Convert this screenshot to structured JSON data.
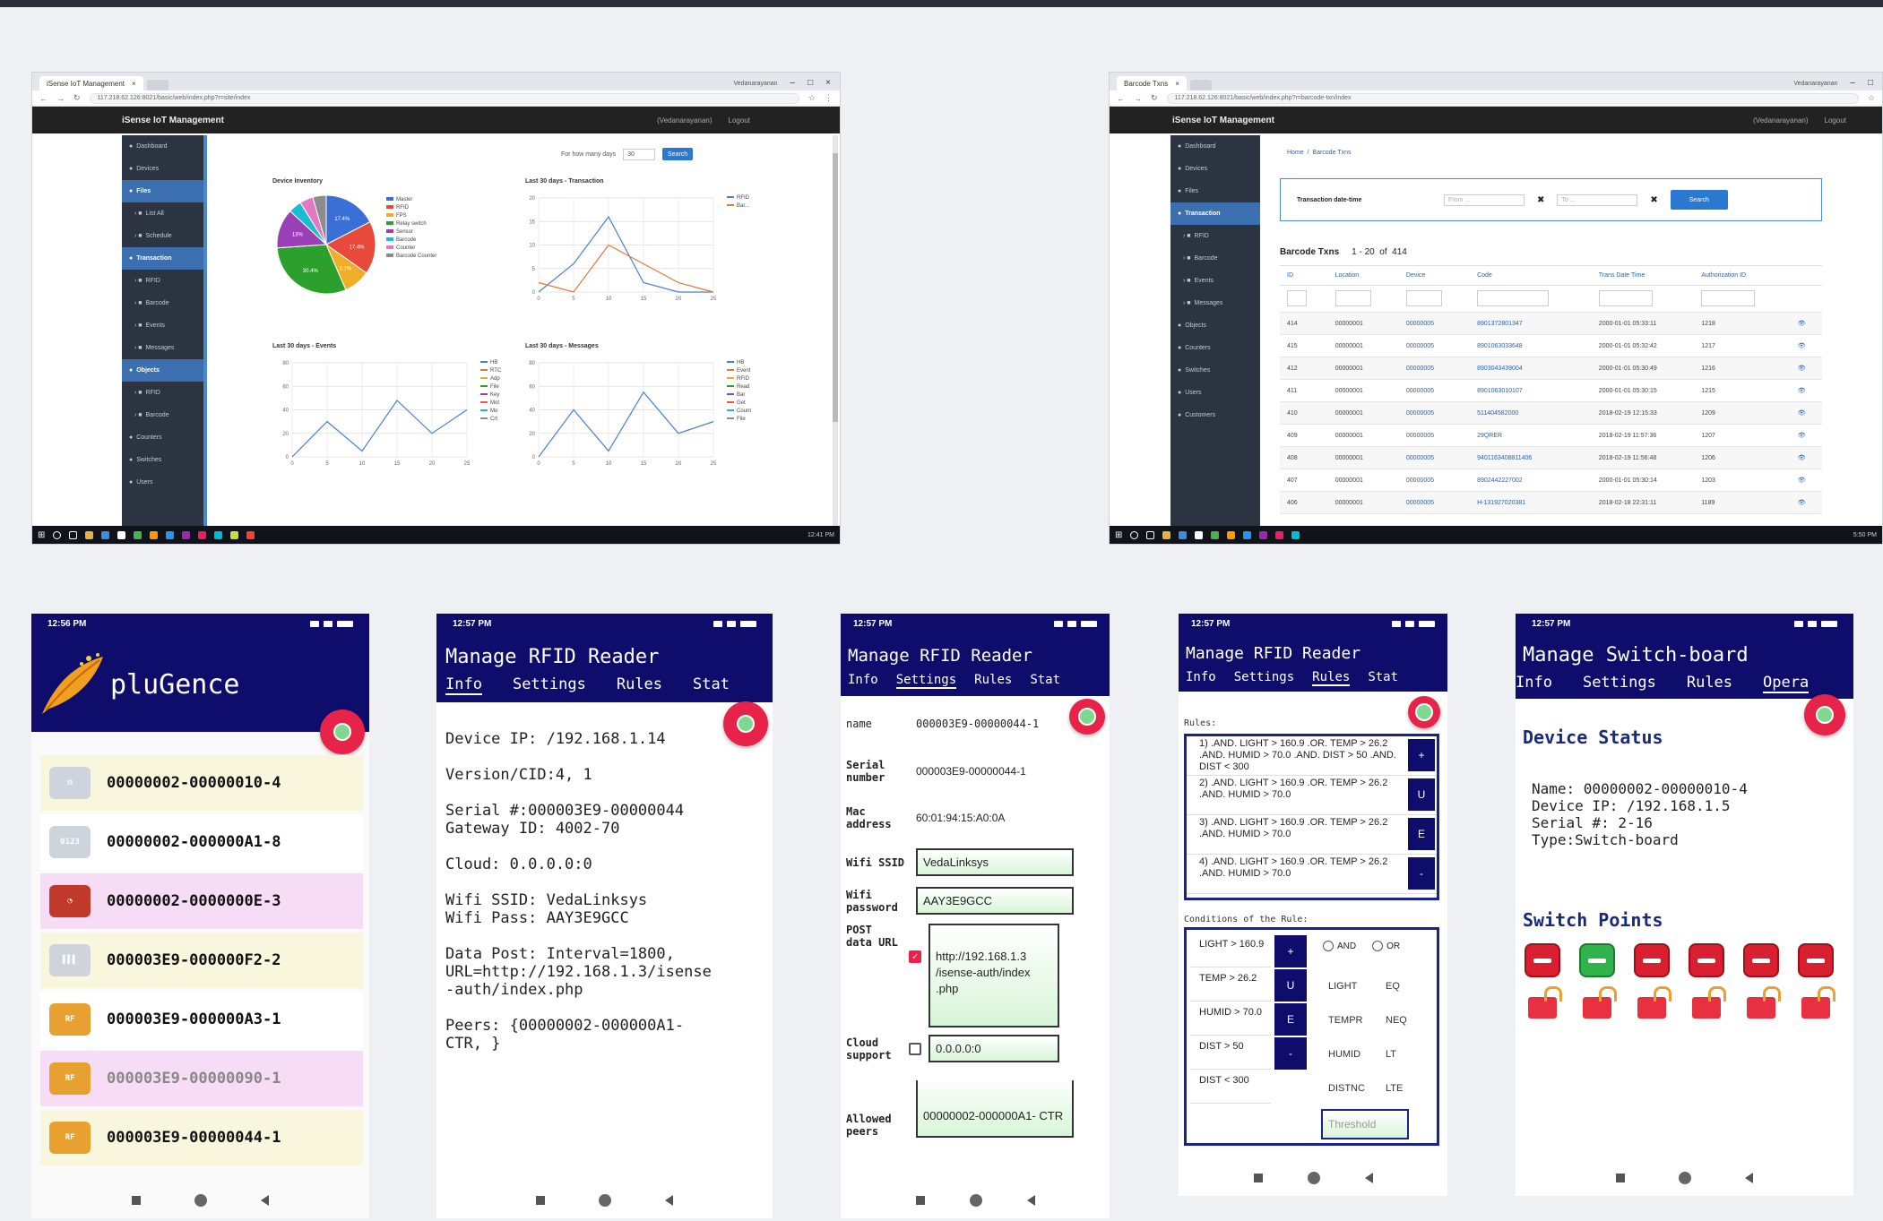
{
  "browser1": {
    "tab_title": "iSense IoT Management",
    "user": "Vedanarayanan",
    "url": "117.218.62.126:8021/basic/web/index.php?r=site/index",
    "app_title": "iSense IoT Management",
    "user_link": "(Vedanarayanan)",
    "logout": "Logout",
    "filter_label": "For how many days",
    "filter_value": "30",
    "search_button": "Search",
    "sidebar": [
      {
        "label": "Dashboard",
        "active": false,
        "sub": false
      },
      {
        "label": "Devices",
        "active": false,
        "sub": false
      },
      {
        "label": "Files",
        "active": true,
        "sub": false
      },
      {
        "label": "List All",
        "active": false,
        "sub": true
      },
      {
        "label": "Schedule",
        "active": false,
        "sub": true
      },
      {
        "label": "Transaction",
        "active": true,
        "sub": false
      },
      {
        "label": "RFID",
        "active": false,
        "sub": true
      },
      {
        "label": "Barcode",
        "active": false,
        "sub": true
      },
      {
        "label": "Events",
        "active": false,
        "sub": true
      },
      {
        "label": "Messages",
        "active": false,
        "sub": true
      },
      {
        "label": "Objects",
        "active": true,
        "sub": false
      },
      {
        "label": "RFID",
        "active": false,
        "sub": true
      },
      {
        "label": "Barcode",
        "active": false,
        "sub": true
      },
      {
        "label": "Counters",
        "active": false,
        "sub": false
      },
      {
        "label": "Switches",
        "active": false,
        "sub": false
      },
      {
        "label": "Users",
        "active": false,
        "sub": false
      }
    ],
    "time": "12:41 PM"
  },
  "charts_text": {
    "pie_title": "Device Inventory",
    "pie_legend": [
      "Master",
      "RFID",
      "FPS",
      "Relay switch",
      "Sensor",
      "Barcode",
      "Counter",
      "Barcode Counter"
    ],
    "pie_colors": [
      "#3b6fd8",
      "#e74a3b",
      "#f0ad2a",
      "#2ca02c",
      "#9b3fb5",
      "#17becf",
      "#e377c2",
      "#8c8c8c"
    ],
    "pie_labels": [
      "17.4%",
      "17.4%",
      "8.7%",
      "30.4%",
      "13%"
    ],
    "txn_title": "Last 30 days - Transaction",
    "txn_legend": [
      "RFID",
      "Bar..."
    ],
    "events_title": "Last 30 days - Events",
    "events_legend": [
      "HB",
      "RTC",
      "Adp",
      "File",
      "Key",
      "Mot",
      "Mo",
      "Crt"
    ],
    "messages_title": "Last 30 days - Messages",
    "messages_legend": [
      "HB",
      "Event",
      "RFID",
      "Read",
      "Bar",
      "Get",
      "Count",
      "File"
    ]
  },
  "chart_data": [
    {
      "type": "pie",
      "title": "Device Inventory",
      "categories": [
        "Master",
        "RFID",
        "FPS",
        "Relay switch",
        "Sensor",
        "Barcode",
        "Counter",
        "Barcode Counter"
      ],
      "values": [
        17.4,
        17.4,
        8.7,
        30.4,
        13,
        4.3,
        4.4,
        4.4
      ]
    },
    {
      "type": "line",
      "title": "Last 30 days - Transaction",
      "x": [
        0,
        5,
        10,
        15,
        20,
        25
      ],
      "series": [
        {
          "name": "RFID",
          "values": [
            0,
            6,
            16,
            2,
            0,
            0
          ]
        },
        {
          "name": "Bar...",
          "values": [
            2,
            0,
            10,
            6,
            2,
            0
          ]
        }
      ],
      "ylim": [
        0,
        20
      ]
    },
    {
      "type": "line",
      "title": "Last 30 days - Events",
      "x": [
        0,
        5,
        10,
        15,
        20,
        25
      ],
      "series": [
        {
          "name": "HB",
          "values": [
            0,
            30,
            5,
            48,
            20,
            40
          ]
        }
      ],
      "ylim": [
        0,
        80
      ]
    },
    {
      "type": "line",
      "title": "Last 30 days - Messages",
      "x": [
        0,
        5,
        10,
        15,
        20,
        25
      ],
      "series": [
        {
          "name": "HB",
          "values": [
            0,
            40,
            5,
            55,
            20,
            30
          ]
        }
      ],
      "ylim": [
        0,
        80
      ]
    }
  ],
  "browser2": {
    "tab_title": "Barcode Txns",
    "user": "Vedanarayanan",
    "url": "117.218.62.126:8021/basic/web/index.php?r=barcode-txn/index",
    "app_title": "iSense IoT Management",
    "user_link": "(Vedanarayanan)",
    "logout": "Logout",
    "breadcrumb": "Home  /  Barcode Txns",
    "filter_label": "Transaction date-time",
    "from": "From ...",
    "to": "To ...",
    "search": "Search",
    "table_title": "Barcode Txns",
    "range": "1 - 20  of  414",
    "columns": [
      "ID",
      "Location",
      "Device",
      "Code",
      "Trans Date Time",
      "Authorization ID"
    ],
    "rows": [
      [
        "414",
        "00000001",
        "00000005",
        "8901372801347",
        "2000-01-01 05:33:11",
        "1218"
      ],
      [
        "415",
        "00000001",
        "00000005",
        "8901063033648",
        "2000-01-01 05:32:42",
        "1217"
      ],
      [
        "412",
        "00000001",
        "00000005",
        "8903043439004",
        "2000-01-01 05:30:49",
        "1216"
      ],
      [
        "411",
        "00000001",
        "00000005",
        "8901063010107",
        "2000-01-01 05:30:15",
        "1215"
      ],
      [
        "410",
        "00000001",
        "00000005",
        "511404582000",
        "2018-02-19 12:15:33",
        "1209"
      ],
      [
        "409",
        "00000001",
        "00000005",
        "29QRER",
        "2018-02-19 11:57:36",
        "1207"
      ],
      [
        "408",
        "00000001",
        "00000005",
        "9401163408811406",
        "2018-02-19 11:56:48",
        "1206"
      ],
      [
        "407",
        "00000001",
        "00000005",
        "8902442227002",
        "2000-01-01 05:30:14",
        "1203"
      ],
      [
        "406",
        "00000001",
        "00000005",
        "H-131927020381",
        "2018-02-18 22:31:11",
        "1189"
      ]
    ],
    "sidebar": [
      {
        "label": "Dashboard",
        "active": false,
        "sub": false
      },
      {
        "label": "Devices",
        "active": false,
        "sub": false
      },
      {
        "label": "Files",
        "active": false,
        "sub": false
      },
      {
        "label": "Transaction",
        "active": true,
        "sub": false
      },
      {
        "label": "RFID",
        "active": false,
        "sub": true
      },
      {
        "label": "Barcode",
        "active": false,
        "sub": true
      },
      {
        "label": "Events",
        "active": false,
        "sub": true
      },
      {
        "label": "Messages",
        "active": false,
        "sub": true
      },
      {
        "label": "Objects",
        "active": false,
        "sub": false
      },
      {
        "label": "Counters",
        "active": false,
        "sub": false
      },
      {
        "label": "Switches",
        "active": false,
        "sub": false
      },
      {
        "label": "Users",
        "active": false,
        "sub": false
      },
      {
        "label": "Customers",
        "active": false,
        "sub": false
      }
    ],
    "time": "5:50 PM"
  },
  "phone1": {
    "time": "12:56 PM",
    "brand": "pluGence",
    "devices": [
      {
        "id": "00000002-00000010-4",
        "bg": "#f8f6dc",
        "icon": "switch-icon"
      },
      {
        "id": "00000002-000000A1-8",
        "bg": "#ffffff",
        "icon": "counter-icon"
      },
      {
        "id": "00000002-0000000E-3",
        "bg": "#f6dcf4",
        "icon": "gauge-icon"
      },
      {
        "id": "000003E9-000000F2-2",
        "bg": "#f8f6dc",
        "icon": "barcode-icon"
      },
      {
        "id": "000003E9-000000A3-1",
        "bg": "#ffffff",
        "icon": "rfid-icon"
      },
      {
        "id": "000003E9-00000090-1",
        "bg": "#f6dcf4",
        "icon": "rfid-icon"
      },
      {
        "id": "000003E9-00000044-1",
        "bg": "#f8f6dc",
        "icon": "rfid-icon"
      }
    ]
  },
  "phone2": {
    "time": "12:57 PM",
    "title": "Manage RFID Reader",
    "tabs": [
      "Info",
      "Settings",
      "Rules",
      "Stat"
    ],
    "info": [
      "Device IP: /192.168.1.14",
      "Version/CID:4, 1",
      "Serial #:000003E9-00000044",
      "Gateway ID: 4002-70",
      "Cloud: 0.0.0.0:0",
      "Wifi SSID: VedaLinksys",
      "Wifi Pass: AAY3E9GCC",
      "Data Post: Interval=1800,",
      "URL=http://192.168.1.3/isense",
      "-auth/index.php",
      "Peers: {00000002-000000A1-",
      "CTR, }"
    ]
  },
  "phone3": {
    "time": "12:57 PM",
    "title": "Manage RFID Reader",
    "tabs": [
      "Info",
      "Settings",
      "Rules",
      "Stat"
    ],
    "cut_label": "name",
    "cut_value": "000003E9-00000044-1",
    "serial_label": "Serial number",
    "serial_value": "000003E9-00000044-1",
    "mac_label": "Mac address",
    "mac_value": "60:01:94:15:A0:0A",
    "ssid_label": "Wifi SSID",
    "ssid_value": "VedaLinksys",
    "pass_label": "Wifi password",
    "pass_value": "AAY3E9GCC",
    "post_label": "POST data URL",
    "post_value": "http://192.168.1.3 /isense-auth/index .php",
    "cloud_label": "Cloud support",
    "cloud_value": "0.0.0.0:0",
    "peers_label": "Allowed peers",
    "peers_value": "00000002-000000A1- CTR"
  },
  "phone4": {
    "time": "12:57 PM",
    "title": "Manage RFID Reader",
    "tabs": [
      "Info",
      "Settings",
      "Rules",
      "Stat"
    ],
    "rules_label": "Rules:",
    "rules": [
      {
        "text": "1) .AND. LIGHT > 160.9 .OR. TEMP > 26.2 .AND. HUMID > 70.0 .AND. DIST > 50 .AND. DIST < 300",
        "btn": "+"
      },
      {
        "text": "2) .AND. LIGHT > 160.9 .OR. TEMP > 26.2 .AND. HUMID > 70.0",
        "btn": "U"
      },
      {
        "text": "3) .AND. LIGHT > 160.9 .OR. TEMP > 26.2 .AND. HUMID > 70.0",
        "btn": "E"
      },
      {
        "text": "4) .AND. LIGHT > 160.9 .OR. TEMP > 26.2 .AND. HUMID > 70.0",
        "btn": "-"
      }
    ],
    "conditions_label": "Conditions of the Rule:",
    "conditions": [
      "LIGHT > 160.9",
      "TEMP > 26.2",
      "HUMID > 70.0",
      "DIST > 50",
      "DIST < 300"
    ],
    "cond_buttons": [
      "+",
      "U",
      "E",
      "-"
    ],
    "and_label": "AND",
    "or_label": "OR",
    "ops": [
      [
        "LIGHT",
        "EQ"
      ],
      [
        "TEMPR",
        "NEQ"
      ],
      [
        "HUMID",
        "LT"
      ],
      [
        "DISTNC",
        "LTE"
      ]
    ],
    "threshold": "Threshold"
  },
  "phone5": {
    "time": "12:57 PM",
    "title": "Manage Switch-board",
    "tabs": [
      "Info",
      "Settings",
      "Rules",
      "Opera"
    ],
    "status_title": "Device Status",
    "name": "Name: 00000002-00000010-4",
    "ip": "Device IP: /192.168.1.5",
    "serial": "Serial #: 2-16",
    "type": "Type:Switch-board",
    "switch_title": "Switch Points",
    "switch_states": [
      "off",
      "on",
      "off",
      "off",
      "off",
      "off"
    ]
  }
}
